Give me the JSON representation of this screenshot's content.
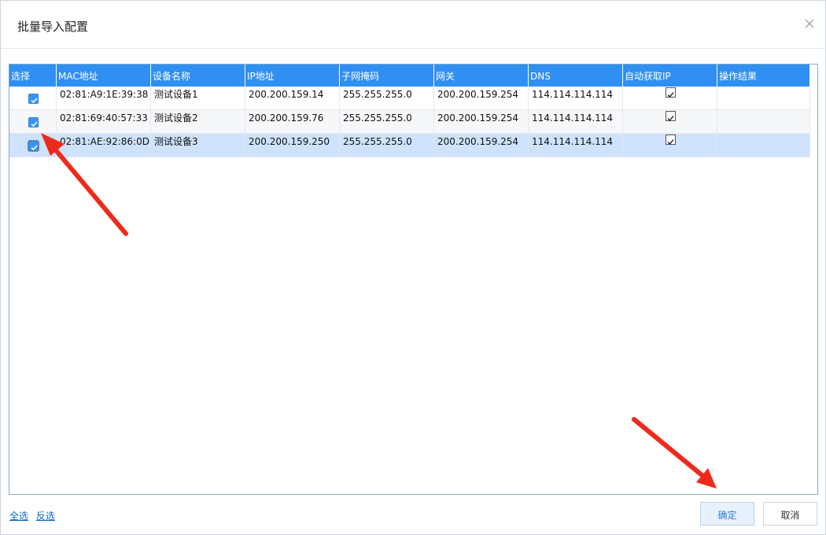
{
  "dialog": {
    "title": "批量导入配置"
  },
  "table": {
    "columns": [
      "选择",
      "MAC地址",
      "设备名称",
      "IP地址",
      "子网掩码",
      "网关",
      "DNS",
      "自动获取IP",
      "操作结果"
    ],
    "rows": [
      {
        "selected": true,
        "mac": "02:81:A9:1E:39:38",
        "name": "测试设备1",
        "ip": "200.200.159.14",
        "mask": "255.255.255.0",
        "gateway": "200.200.159.254",
        "dns": "114.114.114.114",
        "auto_ip": true,
        "result": ""
      },
      {
        "selected": true,
        "mac": "02:81:69:40:57:33",
        "name": "测试设备2",
        "ip": "200.200.159.76",
        "mask": "255.255.255.0",
        "gateway": "200.200.159.254",
        "dns": "114.114.114.114",
        "auto_ip": true,
        "result": ""
      },
      {
        "selected": true,
        "mac": "02:81:AE:92:86:0D",
        "name": "测试设备3",
        "ip": "200.200.159.250",
        "mask": "255.255.255.0",
        "gateway": "200.200.159.254",
        "dns": "114.114.114.114",
        "auto_ip": true,
        "result": ""
      }
    ]
  },
  "footer": {
    "select_all": "全选",
    "invert_select": "反选",
    "ok": "确定",
    "cancel": "取消"
  },
  "colors": {
    "header": "#2f8ff2",
    "row_alt": "#f6f7f9",
    "row_selected": "#cfe2fb",
    "annotation_arrow": "#ee2a1c"
  },
  "icons": {
    "close": "close-icon",
    "checkbox": "checkmark-icon",
    "annotation": "red-arrow-icon"
  }
}
